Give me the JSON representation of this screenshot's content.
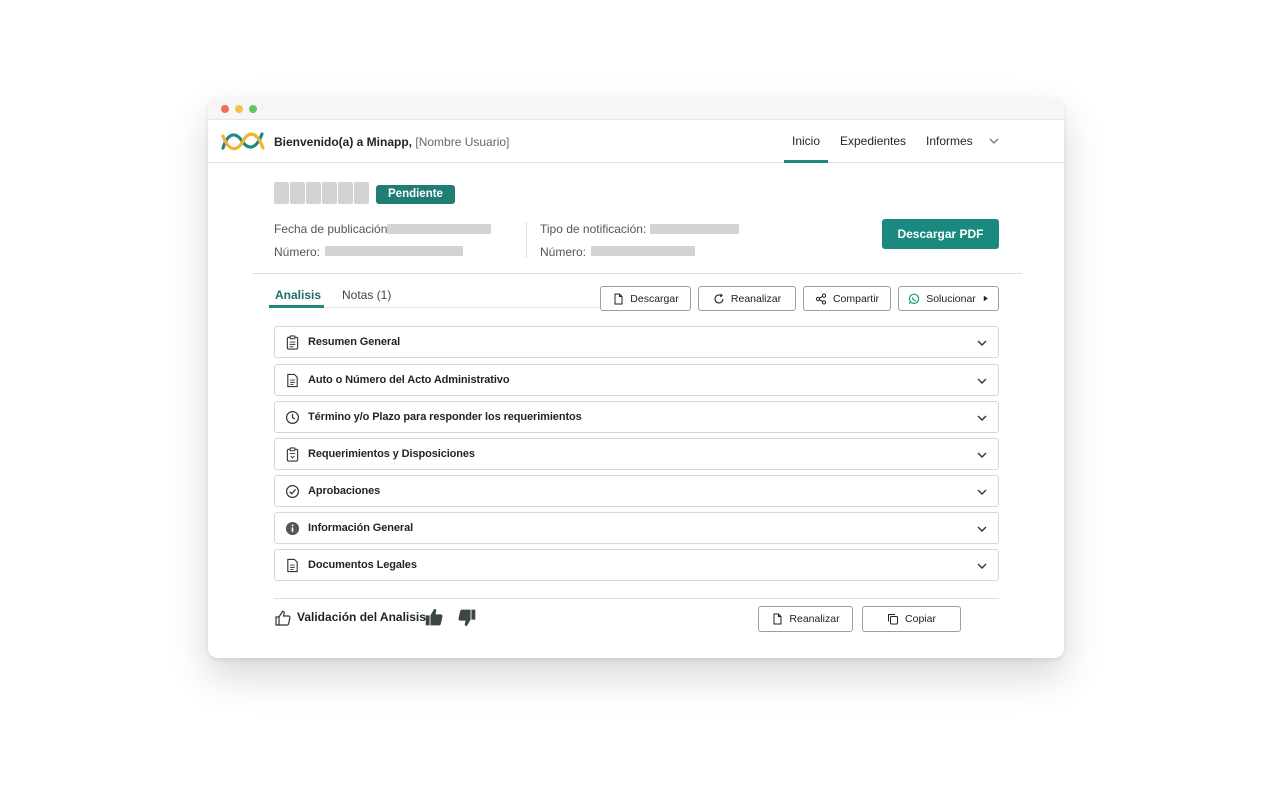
{
  "header": {
    "welcome_bold": "Bienvenido(a) a Minapp,",
    "welcome_user": "[Nombre Usuario]",
    "nav": [
      "Inicio",
      "Expedientes",
      "Informes"
    ],
    "active_nav": "Inicio"
  },
  "record": {
    "status_badge": "Pendiente",
    "fecha_label": "Fecha de publicación:",
    "numero_label_left": "Número:",
    "tipo_label": "Tipo de notificación:",
    "numero_label_right": "Número:",
    "download_pdf_label": "Descargar PDF"
  },
  "tabs": {
    "items": [
      "Analisis",
      "Notas (1)"
    ],
    "active": "Analisis"
  },
  "toolbar": {
    "descargar": "Descargar",
    "reanalizar": "Reanalizar",
    "compartir": "Compartir",
    "solucionar": "Solucionar"
  },
  "sections": [
    {
      "label": "Resumen General",
      "icon": "clipboard-icon"
    },
    {
      "label": "Auto o Número del Acto Administrativo",
      "icon": "document-icon"
    },
    {
      "label": "Término y/o Plazo para responder los requerimientos",
      "icon": "clock-icon"
    },
    {
      "label": "Requerimientos y Disposiciones",
      "icon": "clipboard-sort-icon"
    },
    {
      "label": "Aprobaciones",
      "icon": "check-circle-icon"
    },
    {
      "label": "Información General",
      "icon": "info-icon"
    },
    {
      "label": "Documentos Legales",
      "icon": "document-icon"
    }
  ],
  "footer": {
    "validation_label": "Validación del Analisis",
    "reanalizar": "Reanalizar",
    "copiar": "Copiar"
  },
  "colors": {
    "accent": "#1a8a80",
    "badge": "#1f7d72",
    "placeholder": "#d3d3d3"
  }
}
